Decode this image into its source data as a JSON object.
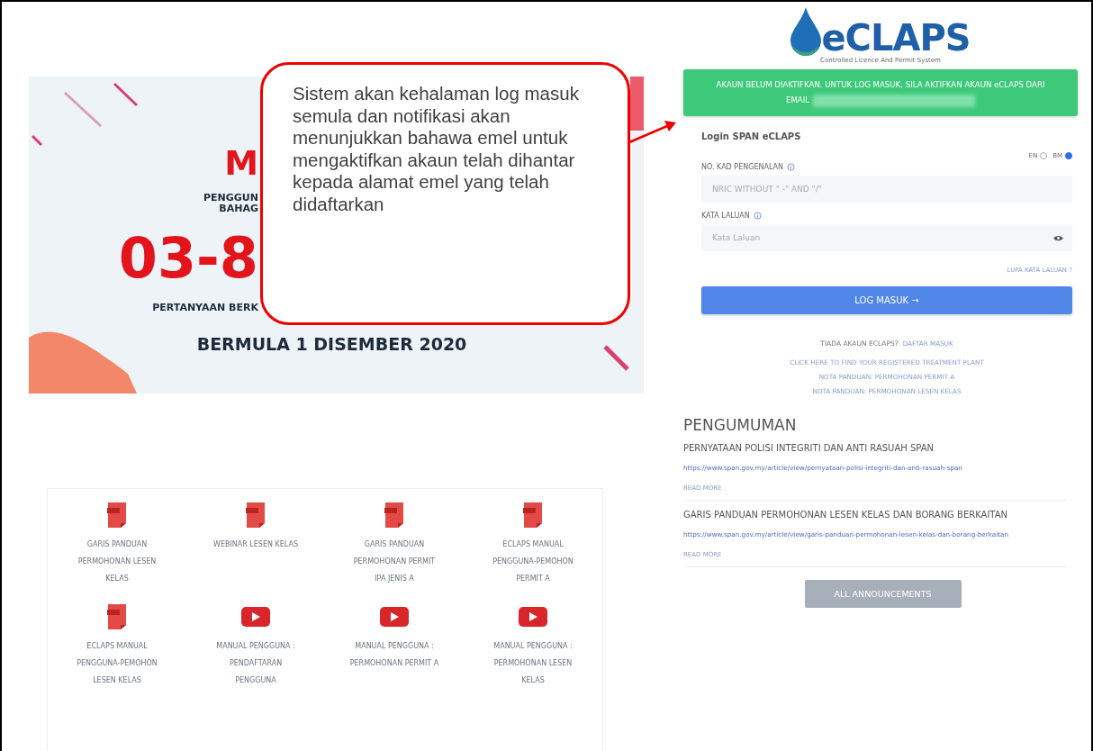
{
  "banner": {
    "fragments": [
      "M",
      "PENGGUN",
      "BAHAG",
      "03-8",
      "PERTANYAAN BERK"
    ],
    "date_line": "BERMULA 1 DISEMBER 2020"
  },
  "callout": {
    "text": "Sistem akan kehalaman log masuk semula dan notifikasi akan menunjukkan bahawa emel untuk mengaktifkan akaun telah dihantar kepada alamat emel yang telah didaftarkan"
  },
  "downloads": [
    {
      "kind": "pdf",
      "label": "GARIS PANDUAN PERMOHONAN LESEN KELAS"
    },
    {
      "kind": "pdf",
      "label": "WEBINAR LESEN KELAS"
    },
    {
      "kind": "pdf",
      "label": "GARIS PANDUAN PERMOHONAN PERMIT IPA JENIS A"
    },
    {
      "kind": "pdf",
      "label": "ECLAPS MANUAL PENGGUNA-PEMOHON PERMIT A"
    },
    {
      "kind": "pdf",
      "label": "ECLAPS MANUAL PENGGUNA-PEMOHON LESEN KELAS"
    },
    {
      "kind": "video",
      "label": "MANUAL PENGGUNA : PENDAFTARAN PENGGUNA"
    },
    {
      "kind": "video",
      "label": "MANUAL PENGGUNA : PERMOHONAN PERMIT A"
    },
    {
      "kind": "video",
      "label": "MANUAL PENGGUNA : PERMOHONAN LESEN KELAS"
    }
  ],
  "logo": {
    "name": "eCLAPS",
    "tagline": "Controlled Licence And Permit System"
  },
  "alert": {
    "text": "AKAUN BELUM DIAKTIFKAN. UNTUK LOG MASUK, SILA AKTIFKAN AKAUN eCLAPS DARI EMAIL"
  },
  "login": {
    "title": "Login SPAN eCLAPS",
    "languages": [
      {
        "label": "EN",
        "selected": false
      },
      {
        "label": "BM",
        "selected": true
      }
    ],
    "fields": [
      {
        "kind": "text",
        "label": "NO. KAD PENGENALAN",
        "placeholder": "NRIC WITHOUT \" -\" AND \"/\""
      },
      {
        "kind": "password",
        "label": "KATA LALUAN",
        "placeholder": "Kata Laluan"
      }
    ],
    "forgot": "LUPA KATA LALUAN ?",
    "submit": "LOG MASUK →",
    "no_account": "TIADA AKAUN ECLAPS?",
    "register": "DAFTAR MASUK",
    "links": [
      "CLICK HERE TO FIND YOUR REGISTERED TREATMENT PLANT",
      "NOTA PANDUAN: PERMOHONAN PERMIT A",
      "NOTA PANDUAN: PERMOHONAN LESEN KELAS"
    ]
  },
  "announcements": {
    "title": "PENGUMUMAN",
    "items": [
      {
        "title": "PERNYATAAN POLISI INTEGRITI DAN ANTI RASUAH SPAN",
        "url": "https://www.span.gov.my/article/view/pernyataan-polisi-integriti-dan-anti-rasuah-span",
        "more": "READ MORE"
      },
      {
        "title": "GARIS PANDUAN PERMOHONAN LESEN KELAS DAN BORANG BERKAITAN",
        "url": "https://www.span.gov.my/article/view/garis-panduan-permohonan-lesen-kelas-dan-borang-berkaitan",
        "more": "READ MORE"
      }
    ],
    "all_button": "ALL ANNOUNCEMENTS"
  }
}
